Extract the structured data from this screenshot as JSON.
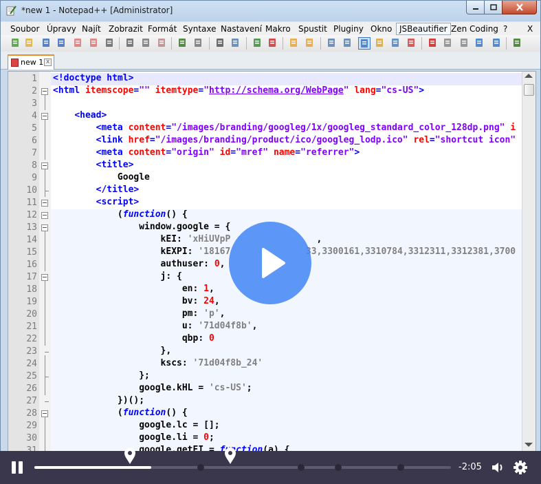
{
  "window": {
    "title": "*new 1 - Notepad++ [Administrator]",
    "buttons": {
      "minimize": "minimize",
      "maximize": "maximize",
      "close": "close"
    }
  },
  "menu": {
    "items": [
      "Soubor",
      "Úpravy",
      "Najít",
      "Zobrazit",
      "Formát",
      "Syntaxe",
      "Nastavení",
      "Makro",
      "Spustit",
      "Pluginy",
      "Okno",
      "JSBeautifier",
      "Zen Coding",
      "?"
    ],
    "close_glyph": "X"
  },
  "toolbar": {
    "icons": [
      "new-file-icon",
      "open-file-icon",
      "save-icon",
      "save-all-icon",
      "close-icon",
      "close-all-icon",
      "print-icon",
      "cut-icon",
      "copy-icon",
      "paste-icon",
      "undo-icon",
      "redo-icon",
      "find-icon",
      "replace-icon",
      "zoom-in-icon",
      "zoom-out-icon",
      "sync-v-icon",
      "sync-h-icon",
      "word-wrap-icon",
      "show-all-chars-icon",
      "indent-guide-icon",
      "doc-map-icon",
      "function-list-icon",
      "folder-workspace-icon",
      "record-macro-icon",
      "stop-macro-icon",
      "play-macro-icon",
      "run-macro-multiple-icon",
      "save-macro-icon",
      "plugin-icon"
    ],
    "active_icon": "indent-guide-icon"
  },
  "tabs": [
    {
      "label": "new 1",
      "close": "x",
      "active": true,
      "modified": true
    }
  ],
  "editor": {
    "lines": [
      {
        "n": "1",
        "html": "<span class='tag'>&lt;!doctype html&gt;</span>",
        "hl": true
      },
      {
        "n": "2",
        "html": "<span class='tag'>&lt;html</span> <span class='attr'>itemscope</span><span class='tag'>=</span><span class='val'>\"\"</span> <span class='attr'>itemtype</span><span class='tag'>=</span><span class='val'>\"</span><span class='url'>http://schema.org/WebPage</span><span class='val'>\"</span> <span class='attr'>lang</span><span class='tag'>=</span><span class='val'>\"cs-US\"</span><span class='tag'>&gt;</span>"
      },
      {
        "n": "3",
        "html": ""
      },
      {
        "n": "4",
        "html": "    <span class='tag'>&lt;head&gt;</span>"
      },
      {
        "n": "5",
        "html": "        <span class='tag'>&lt;meta</span> <span class='attr'>content</span><span class='tag'>=</span><span class='val'>\"/images/branding/googleg/1x/googleg_standard_color_128dp.png\"</span> <span class='attr'>i</span>"
      },
      {
        "n": "6",
        "html": "        <span class='tag'>&lt;link</span> <span class='attr'>href</span><span class='tag'>=</span><span class='val'>\"/images/branding/product/ico/googleg_lodp.ico\"</span> <span class='attr'>rel</span><span class='tag'>=</span><span class='val'>\"shortcut icon\"</span>"
      },
      {
        "n": "7",
        "html": "        <span class='tag'>&lt;meta</span> <span class='attr'>content</span><span class='tag'>=</span><span class='val'>\"origin\"</span> <span class='attr'>id</span><span class='tag'>=</span><span class='val'>\"mref\"</span> <span class='attr'>name</span><span class='tag'>=</span><span class='val'>\"referrer\"</span><span class='tag'>&gt;</span>"
      },
      {
        "n": "8",
        "html": "        <span class='tag'>&lt;title&gt;</span>"
      },
      {
        "n": "9",
        "html": "            <span class='txt'>Google</span>"
      },
      {
        "n": "10",
        "html": "        <span class='tag'>&lt;/title&gt;</span>"
      },
      {
        "n": "11",
        "html": "        <span class='tag'>&lt;script&gt;</span>"
      },
      {
        "n": "12",
        "html": "            <span class='txt'>(</span><span class='kw'>function</span><span class='txt'>() {</span>",
        "js": true
      },
      {
        "n": "13",
        "html": "                <span class='txt'>window.google = {</span>",
        "js": true
      },
      {
        "n": "14",
        "html": "                    <span class='txt'>kEI: </span><span class='str'>'xHiUVpP</span>                <span class='txt'>,</span>",
        "js": true
      },
      {
        "n": "15",
        "html": "                    <span class='txt'>kEXPI: </span><span class='str'>'18167</span>              <span class='str'>33,3300161,3310784,3312311,3312381,3700</span>",
        "js": true
      },
      {
        "n": "16",
        "html": "                    <span class='txt'>authuser: </span><span class='num'>0</span><span class='txt'>,</span>",
        "js": true
      },
      {
        "n": "17",
        "html": "                    <span class='txt'>j: {</span>",
        "js": true
      },
      {
        "n": "18",
        "html": "                        <span class='txt'>en: </span><span class='num'>1</span><span class='txt'>,</span>",
        "js": true
      },
      {
        "n": "19",
        "html": "                        <span class='txt'>bv: </span><span class='num'>24</span><span class='txt'>,</span>",
        "js": true
      },
      {
        "n": "20",
        "html": "                        <span class='txt'>pm: </span><span class='str'>'p'</span><span class='txt'>,</span>",
        "js": true
      },
      {
        "n": "21",
        "html": "                        <span class='txt'>u: </span><span class='str'>'71d04f8b'</span><span class='txt'>,</span>",
        "js": true
      },
      {
        "n": "22",
        "html": "                        <span class='txt'>qbp: </span><span class='num'>0</span>",
        "js": true
      },
      {
        "n": "23",
        "html": "                    <span class='txt'>},</span>",
        "js": true
      },
      {
        "n": "24",
        "html": "                    <span class='txt'>kscs: </span><span class='str'>'71d04f8b_24'</span>",
        "js": true
      },
      {
        "n": "25",
        "html": "                <span class='txt'>};</span>",
        "js": true
      },
      {
        "n": "26",
        "html": "                <span class='txt'>google.kHL = </span><span class='str'>'cs-US'</span><span class='txt'>;</span>",
        "js": true
      },
      {
        "n": "27",
        "html": "            <span class='txt'>})();</span>",
        "js": true
      },
      {
        "n": "28",
        "html": "            <span class='txt'>(</span><span class='kw'>function</span><span class='txt'>() {</span>",
        "js": true
      },
      {
        "n": "29",
        "html": "                <span class='txt'>google.lc = [];</span>",
        "js": true
      },
      {
        "n": "30",
        "html": "                <span class='txt'>google.li = </span><span class='num'>0</span><span class='txt'>;</span>",
        "js": true
      },
      {
        "n": "31",
        "html": "                <span class='txt'>google.getEI = </span><span class='kw'>function</span><span class='txt'>(a) {</span>",
        "js": true
      }
    ]
  },
  "player": {
    "remaining_time": "-2:05",
    "progress": 0.28,
    "chapter_marks": [
      0.4,
      0.64,
      0.73,
      0.88
    ],
    "pin_marks": [
      0.23,
      0.47
    ],
    "icons": {
      "play": "play-icon",
      "pause": "pause-icon",
      "volume": "volume-icon",
      "settings": "gear-icon"
    }
  }
}
